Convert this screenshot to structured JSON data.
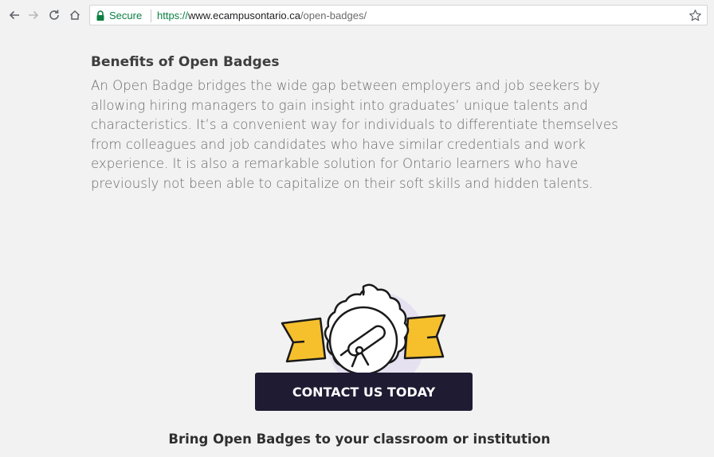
{
  "browser": {
    "secure_label": "Secure",
    "url_scheme": "https://",
    "url_host": "www.ecampusontario.ca",
    "url_path": "/open-badges/"
  },
  "content": {
    "heading": "Benefits of Open Badges",
    "body": "An Open Badge bridges the wide gap between employers and job seekers by allowing hiring managers to gain insight into graduates’ unique talents and characteristics. It’s a convenient way for individuals to differentiate themselves from colleagues and job candidates who have similar credentials and work experience. It is also a remarkable solution for Ontario learners who have previously not been able to capitalize on their soft skills and hidden talents.",
    "cta_label": "CONTACT US TODAY",
    "sub_heading": "Bring Open Badges to your classroom or institution"
  },
  "colors": {
    "cta_background": "#1f1b33",
    "ribbon": "#f5c02c",
    "secure_green": "#0b8043"
  },
  "icons": {
    "back": "back-arrow-icon",
    "forward": "forward-arrow-icon",
    "reload": "reload-icon",
    "home": "home-icon",
    "lock": "lock-icon",
    "bookmark": "star-icon",
    "badge": "telescope-badge-icon"
  }
}
